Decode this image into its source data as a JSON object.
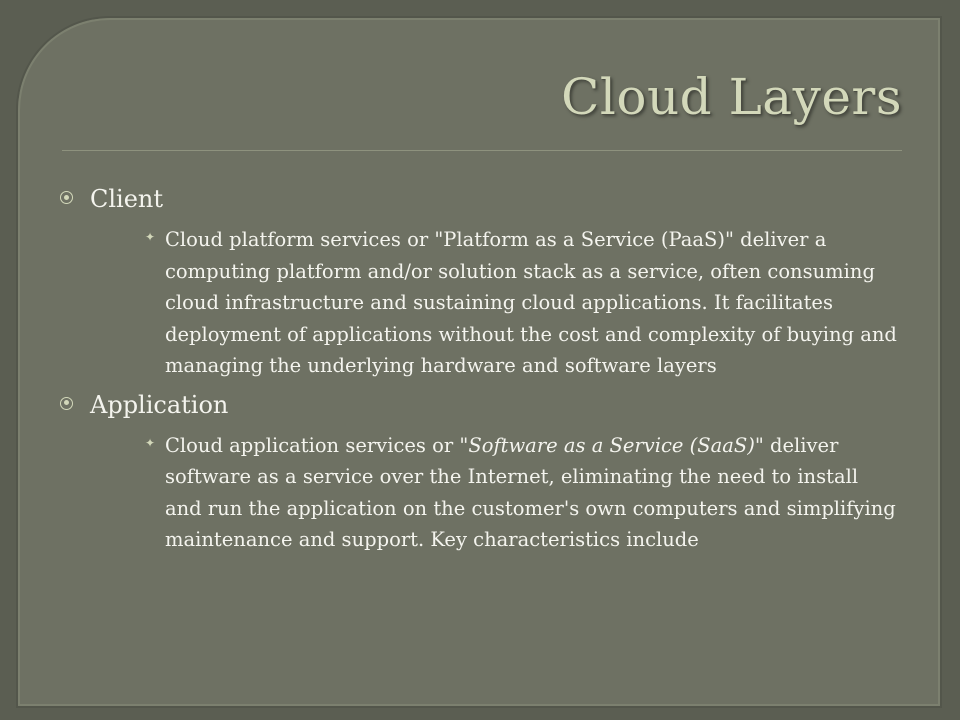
{
  "slide": {
    "title": "Cloud Layers",
    "sections": [
      {
        "heading": "Client",
        "body": "Cloud platform services or \"Platform as a Service (PaaS)\" deliver a computing platform and/or solution stack as a service, often consuming cloud infrastructure and sustaining cloud applications. It facilitates deployment of applications without the cost and complexity of buying and managing the underlying hardware and software layers"
      },
      {
        "heading": "Application",
        "body_prefix": "Cloud application services or \"",
        "body_italic": "Software as a Service (SaaS)",
        "body_suffix": "\" deliver software as a service over the Internet, eliminating the need to install and run the application on the customer's own computers and simplifying maintenance and support. Key characteristics include"
      }
    ]
  },
  "colors": {
    "background": "#5b5e52",
    "panel": "#6e7163",
    "title": "#d3d8ba",
    "text": "#f4f4ee"
  },
  "icons": {
    "level1_bullet": "circled-dot-icon",
    "level2_bullet": "four-point-star-icon"
  }
}
